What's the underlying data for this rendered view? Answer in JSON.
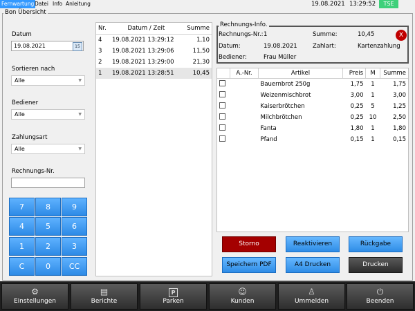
{
  "menu": {
    "items": [
      "Fernwartung",
      "Datei",
      "Info",
      "Anleitung"
    ],
    "date": "19.08.2021",
    "time": "13:29:52",
    "tse": "TSE"
  },
  "group_title": "Bon Übersicht",
  "filters": {
    "date_label": "Datum",
    "date_value": "19.08.2021",
    "sort_label": "Sortieren nach",
    "sort_value": "Alle",
    "waiter_label": "Bediener",
    "waiter_value": "Alle",
    "payment_label": "Zahlungsart",
    "payment_value": "Alle",
    "invoice_label": "Rechnungs-Nr.",
    "invoice_value": ""
  },
  "keypad": [
    "7",
    "8",
    "9",
    "4",
    "5",
    "6",
    "1",
    "2",
    "3",
    "C",
    "0",
    "CC"
  ],
  "bills": {
    "headers": [
      "Nr.",
      "Datum / Zeit",
      "Summe"
    ],
    "rows": [
      {
        "nr": "4",
        "dt": "19.08.2021 13:29:12",
        "sum": "1,10"
      },
      {
        "nr": "3",
        "dt": "19.08.2021 13:29:06",
        "sum": "11,50"
      },
      {
        "nr": "2",
        "dt": "19.08.2021 13:29:00",
        "sum": "21,30"
      },
      {
        "nr": "1",
        "dt": "19.08.2021 13:28:51",
        "sum": "10,45"
      }
    ]
  },
  "info": {
    "title": "Rechnungs-Info.",
    "nr_label": "Rechnungs-Nr.:",
    "nr_value": "1",
    "sum_label": "Summe:",
    "sum_value": "10,45",
    "date_label": "Datum:",
    "date_value": "19.08.2021",
    "pay_label": "Zahlart:",
    "pay_value": "Kartenzahlung",
    "waiter_label": "Bediener:",
    "waiter_value": "Frau Müller",
    "close": "X"
  },
  "items": {
    "headers": [
      "",
      "A.-Nr.",
      "Artikel",
      "Preis",
      "M",
      "Summe"
    ],
    "rows": [
      {
        "anr": "",
        "name": "Bauernbrot 250g",
        "price": "1,75",
        "qty": "1",
        "sum": "1,75"
      },
      {
        "anr": "",
        "name": "Weizenmischbrot",
        "price": "3,00",
        "qty": "1",
        "sum": "3,00"
      },
      {
        "anr": "",
        "name": "Kaiserbrötchen",
        "price": "0,25",
        "qty": "5",
        "sum": "1,25"
      },
      {
        "anr": "",
        "name": "Milchbrötchen",
        "price": "0,25",
        "qty": "10",
        "sum": "2,50"
      },
      {
        "anr": "",
        "name": "Fanta",
        "price": "1,80",
        "qty": "1",
        "sum": "1,80"
      },
      {
        "anr": "",
        "name": "Pfand",
        "price": "0,15",
        "qty": "1",
        "sum": "0,15"
      }
    ]
  },
  "actions": {
    "storno": "Storno",
    "reactivate": "Reaktivieren",
    "refund": "Rückgabe",
    "save_pdf": "Speichern PDF",
    "a4": "A4 Drucken",
    "print": "Drucken"
  },
  "toolbar": [
    {
      "label": "Einstellungen",
      "icon": "gear-icon",
      "glyph": "⚙"
    },
    {
      "label": "Berichte",
      "icon": "clipboard-icon",
      "glyph": "▤"
    },
    {
      "label": "Parken",
      "icon": "parking-icon",
      "glyph": "P"
    },
    {
      "label": "Kunden",
      "icon": "users-icon",
      "glyph": "☺"
    },
    {
      "label": "Ummelden",
      "icon": "user-switch-icon",
      "glyph": "♙"
    },
    {
      "label": "Beenden",
      "icon": "power-icon",
      "glyph": "⏻"
    }
  ]
}
